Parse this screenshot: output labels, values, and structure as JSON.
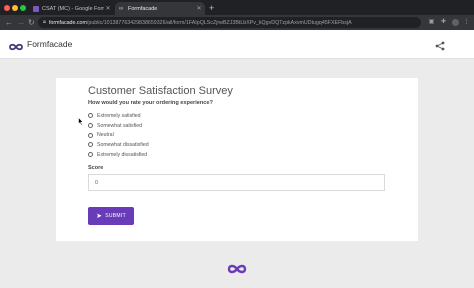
{
  "browser": {
    "tabs": [
      {
        "title": "CSAT (MC) - Google Forms",
        "favicon": "google-forms-icon",
        "active": false
      },
      {
        "title": "Formfacade",
        "favicon": "formfacade-icon",
        "active": true
      }
    ],
    "url": {
      "host": "formfacade.com",
      "path": "/public/101387763429838659326/all/form/1FAIpQLScZjrwBZJ3BtLbXPv_kQgvDQTzpkAxvmUDtugq45FXEFbsjA"
    }
  },
  "app": {
    "brand": "Formfacade",
    "accent_color": "#6a3bb9"
  },
  "form": {
    "title": "Customer Satisfaction Survey",
    "question": "How would you rate your ordering experience?",
    "options": [
      "Extremely satisfied",
      "Somewhat satisfied",
      "Neutral",
      "Somewhat dissatisfied",
      "Extremely dissatisfied"
    ],
    "score_label": "Score",
    "score_value": "0",
    "submit_label": "SUBMIT"
  }
}
